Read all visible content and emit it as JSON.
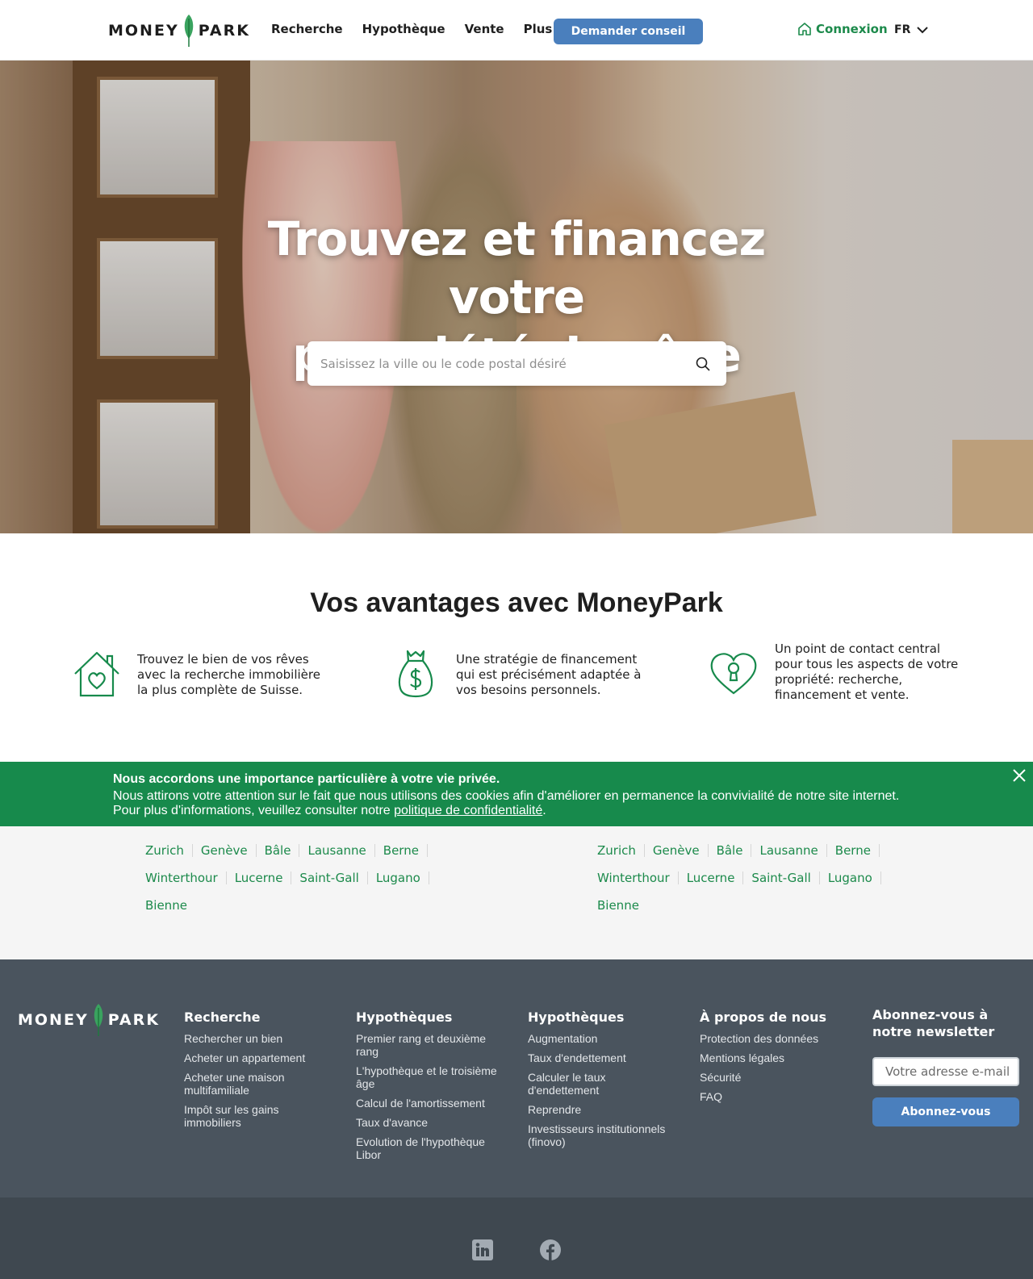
{
  "header": {
    "logo": {
      "left": "MONEY",
      "right": "PARK"
    },
    "nav": [
      "Recherche",
      "Hypothèque",
      "Vente",
      "Plus"
    ],
    "cta": "Demander conseil",
    "login": "Connexion",
    "lang": "FR"
  },
  "hero": {
    "title_line1": "Trouvez et financez votre",
    "title_line2": "propriété de rêve",
    "search_placeholder": "Saisissez la ville ou le code postal désiré"
  },
  "advantages": {
    "title": "Vos avantages avec MoneyPark",
    "items": [
      {
        "icon": "house-heart-icon",
        "lines": [
          "Trouvez le bien de vos rêves",
          "avec la recherche immobilière",
          "la plus complète de Suisse."
        ]
      },
      {
        "icon": "money-bag-icon",
        "lines": [
          "Une stratégie de financement",
          "qui est précisément adaptée à",
          "vos besoins personnels."
        ]
      },
      {
        "icon": "heart-keyhole-icon",
        "lines": [
          "Un point de contact central",
          "pour tous les aspects de votre",
          "propriété: recherche,",
          "financement et vente."
        ]
      }
    ]
  },
  "cookie": {
    "title": "Nous accordons une importance particulière à votre vie privée.",
    "line1": "Nous attirons votre attention sur le fait que nous utilisons des cookies afin d'améliorer en permanence la convivialité de notre site internet.",
    "line2_prefix": "Pour plus d'informations, veuillez consulter notre",
    "link": "politique de confidentialité",
    "line2_suffix": "."
  },
  "cities": {
    "left": [
      [
        "Zurich",
        "Genève",
        "Bâle",
        "Lausanne",
        "Berne"
      ],
      [
        "Winterthour",
        "Lucerne",
        "Saint-Gall",
        "Lugano"
      ],
      [
        "Bienne"
      ]
    ],
    "right": [
      [
        "Zurich",
        "Genève",
        "Bâle",
        "Lausanne",
        "Berne"
      ],
      [
        "Winterthour",
        "Lucerne",
        "Saint-Gall",
        "Lugano"
      ],
      [
        "Bienne"
      ]
    ]
  },
  "footer": {
    "logo": {
      "left": "MONEY",
      "right": "PARK"
    },
    "columns": [
      {
        "title": "Recherche",
        "links": [
          "Rechercher un bien",
          "Acheter un appartement",
          "Acheter une maison multifamiliale",
          "Impôt sur les gains immobiliers"
        ]
      },
      {
        "title": "Hypothèques",
        "links": [
          "Premier rang et deuxième rang",
          "L'hypothèque et le troisième âge",
          "Calcul de l'amortissement",
          "Taux d'avance",
          "Evolution de l'hypothèque Libor"
        ]
      },
      {
        "title": "Hypothèques",
        "links": [
          "Augmentation",
          "Taux d'endettement",
          "Calculer le taux d'endettement",
          "Reprendre",
          "Investisseurs institutionnels (finovo)"
        ]
      },
      {
        "title": "À propos de nous",
        "links": [
          "Protection des données",
          "Mentions légales",
          "Sécurité",
          "FAQ"
        ]
      }
    ],
    "newsletter": {
      "title": "Abonnez-vous à notre newsletter",
      "placeholder": "Votre adresse e-mail",
      "button": "Abonnez-vous"
    }
  },
  "social": [
    "linkedin-icon",
    "facebook-icon"
  ],
  "colors": {
    "green": "#178a4c",
    "blue": "#4a7fbd",
    "footer": "#4a545e"
  }
}
